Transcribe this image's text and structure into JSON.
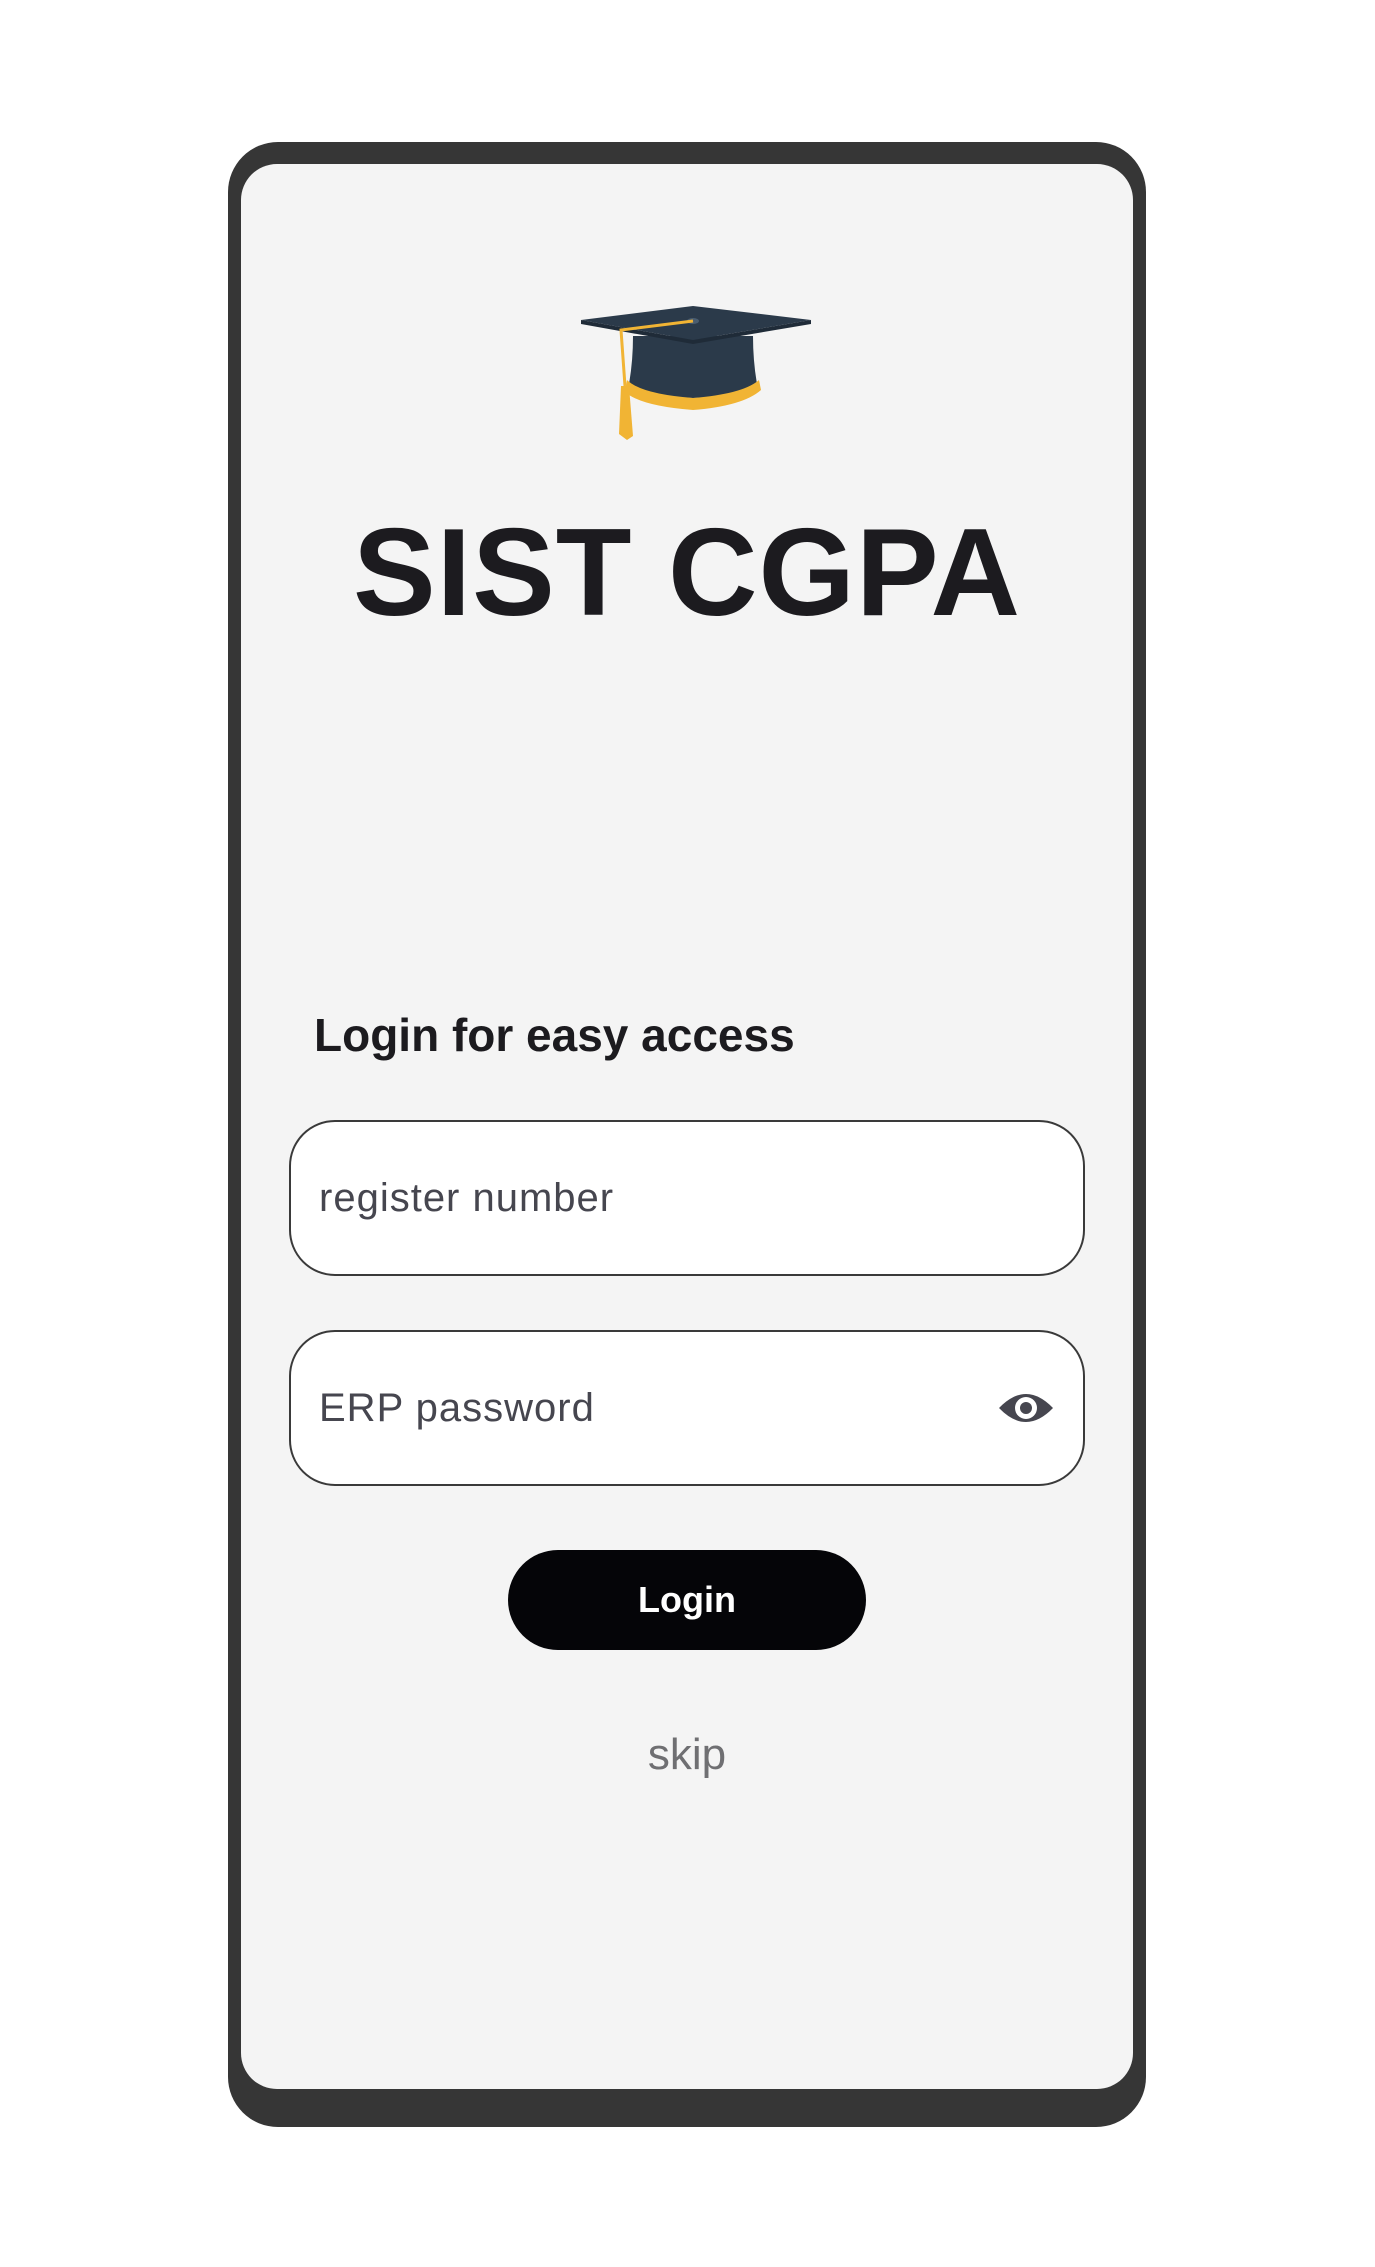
{
  "app": {
    "title": "SIST CGPA",
    "logo_icon": "graduation-cap-icon"
  },
  "login": {
    "heading": "Login for easy access",
    "register_placeholder": "register number",
    "password_placeholder": "ERP password",
    "password_toggle_icon": "eye-icon",
    "login_label": "Login",
    "skip_label": "skip"
  },
  "colors": {
    "screen_background": "#f4f4f4",
    "frame": "#363636",
    "button_background": "#050508",
    "cap_body": "#2b3a4a",
    "cap_gold": "#f1b434"
  }
}
